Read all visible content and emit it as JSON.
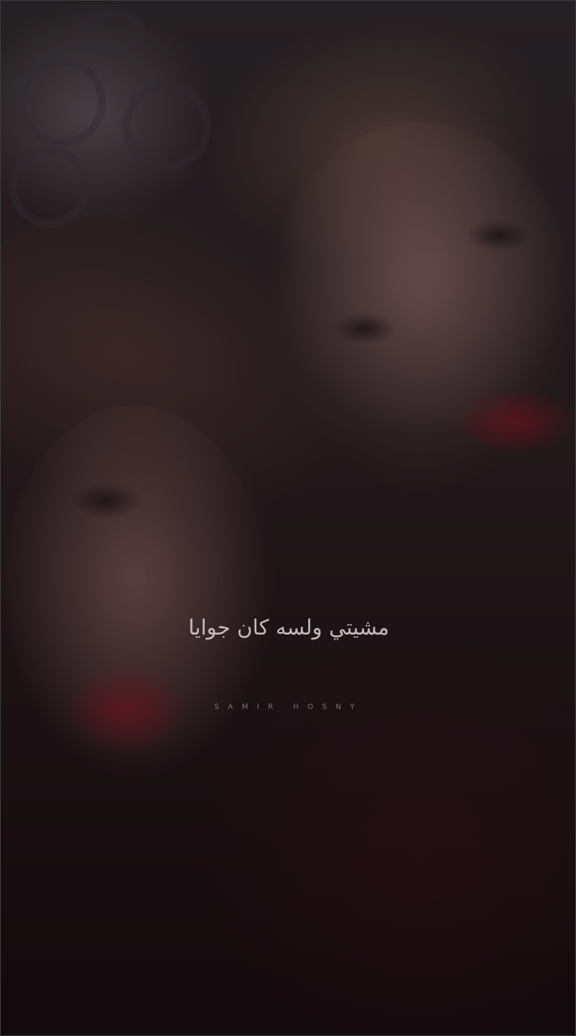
{
  "overlay": {
    "lyric_text": "مشيتي ولسه كان جوايا",
    "credit_text": "SAMIR  HOSNY"
  },
  "colors": {
    "background": "#1b1214",
    "lyric_color": "#e1d7d7",
    "lips_red": "#821923"
  }
}
